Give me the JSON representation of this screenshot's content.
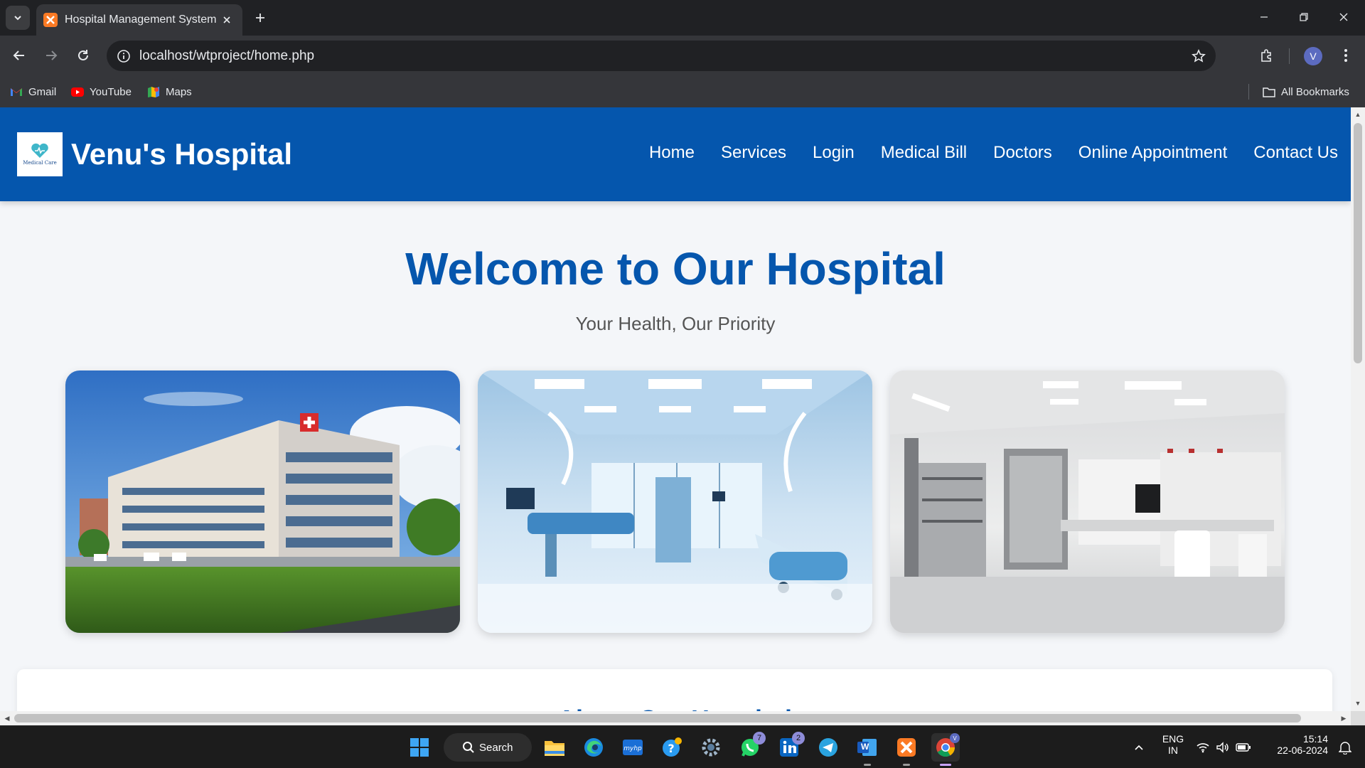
{
  "browser": {
    "tab_title": "Hospital Management System",
    "url": "localhost/wtproject/home.php",
    "profile_initial": "V",
    "bookmarks": [
      {
        "label": "Gmail",
        "icon": "gmail-icon"
      },
      {
        "label": "YouTube",
        "icon": "youtube-icon"
      },
      {
        "label": "Maps",
        "icon": "maps-icon"
      }
    ],
    "all_bookmarks_label": "All Bookmarks"
  },
  "site": {
    "logo_text": "Medical Care",
    "brand": "Venu's Hospital",
    "nav": [
      "Home",
      "Services",
      "Login",
      "Medical Bill",
      "Doctors",
      "Online Appointment",
      "Contact Us"
    ],
    "hero_title": "Welcome to Our Hospital",
    "hero_subtitle": "Your Health, Our Priority",
    "photos": [
      "hospital-building-photo",
      "operating-room-photo",
      "laboratory-photo"
    ],
    "about_title": "About Our Hospital"
  },
  "taskbar": {
    "search_label": "Search",
    "whatsapp_badge": "7",
    "linkedin_badge": "2",
    "word_label": "W",
    "language": "ENG",
    "region": "IN",
    "time": "15:14",
    "date": "22-06-2024"
  },
  "colors": {
    "header_blue": "#0556ad",
    "page_bg": "#f4f6f9",
    "chrome_dark": "#202124",
    "chrome_mid": "#35363a"
  }
}
